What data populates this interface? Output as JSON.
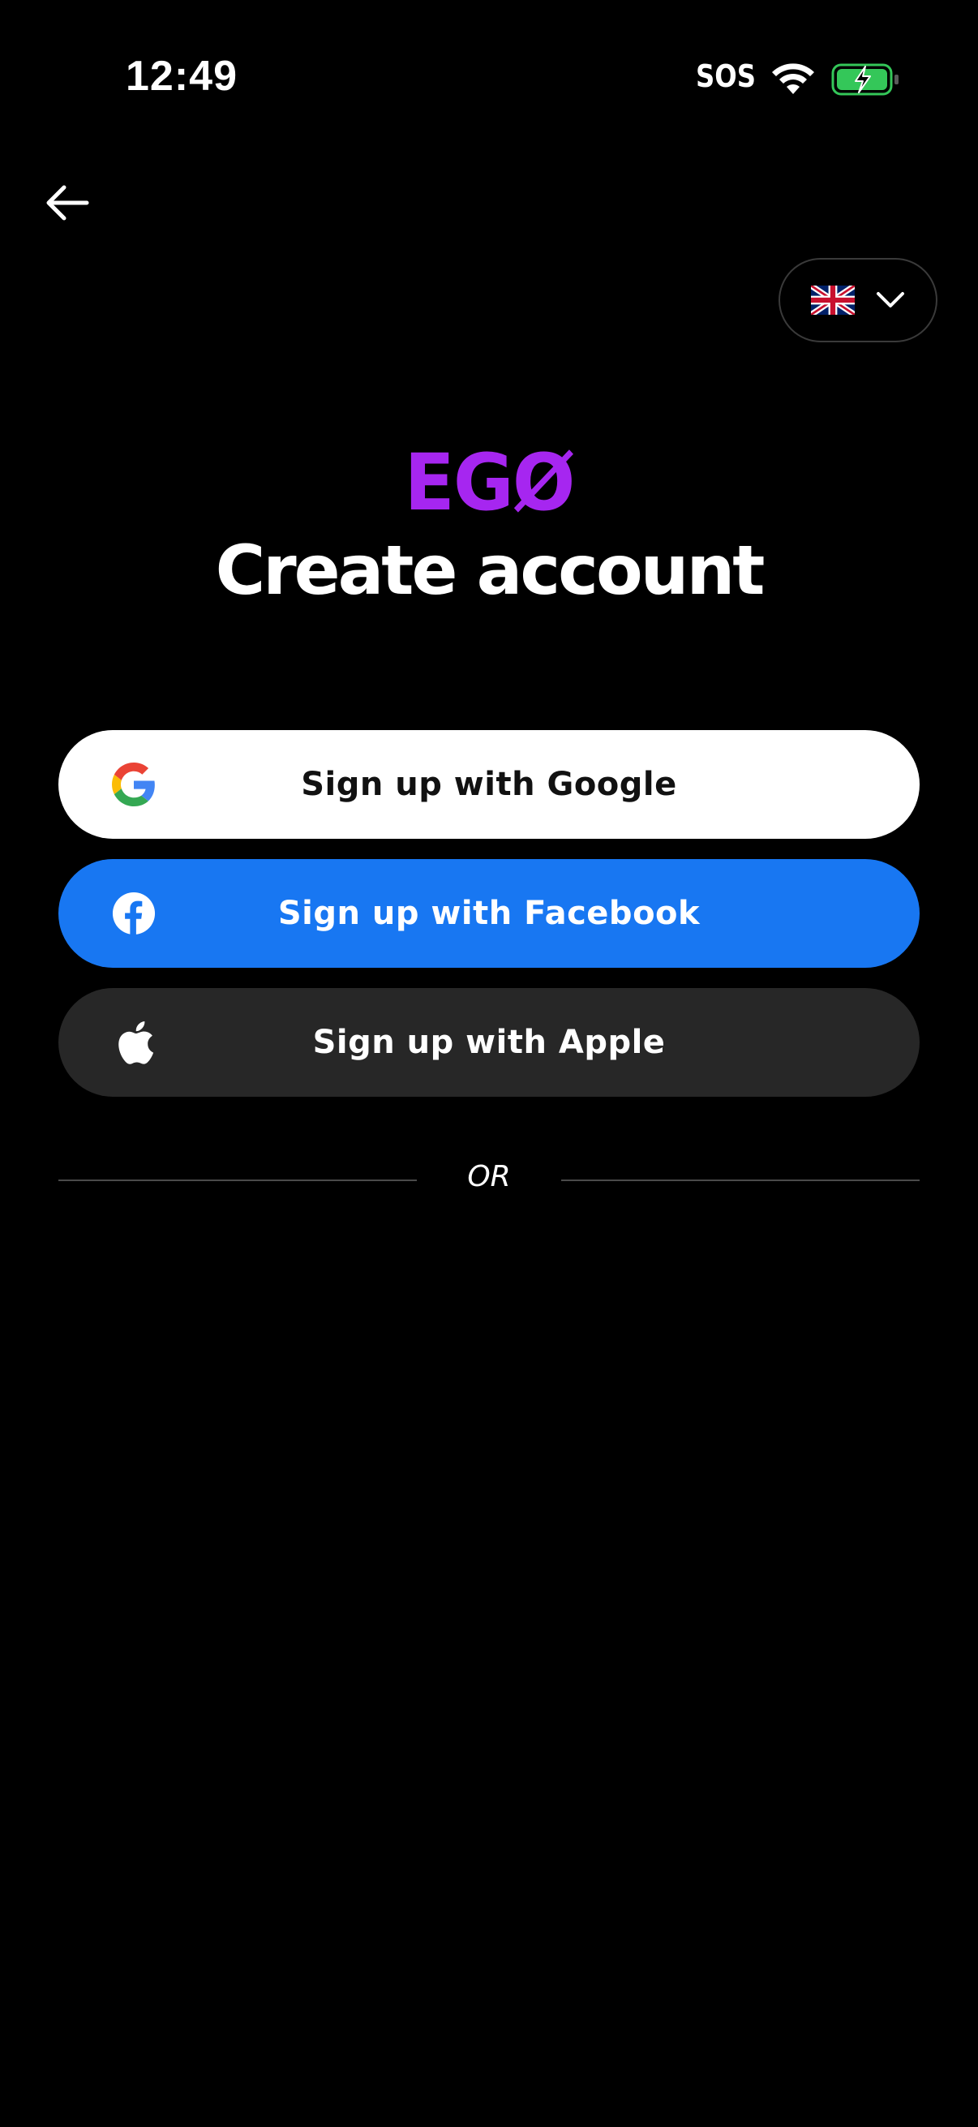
{
  "status_bar": {
    "time": "12:49",
    "carrier": "SOS",
    "wifi_icon": "wifi-icon",
    "battery_icon": "battery-charging-icon",
    "battery_color": "#34c759"
  },
  "header": {
    "back_icon": "arrow-left-icon",
    "language": {
      "flag_icon": "uk-flag-icon",
      "chevron_icon": "chevron-down-icon"
    }
  },
  "brand": {
    "logo_text": "EGØ",
    "accent_color": "#a626f0"
  },
  "page": {
    "title": "Create account"
  },
  "auth_buttons": [
    {
      "label": "Sign up with Google",
      "icon": "google-icon",
      "bg": "#ffffff"
    },
    {
      "label": "Sign up with Facebook",
      "icon": "facebook-icon",
      "bg": "#1877f2"
    },
    {
      "label": "Sign up with Apple",
      "icon": "apple-icon",
      "bg": "#272727"
    }
  ],
  "divider": {
    "text": "OR"
  }
}
